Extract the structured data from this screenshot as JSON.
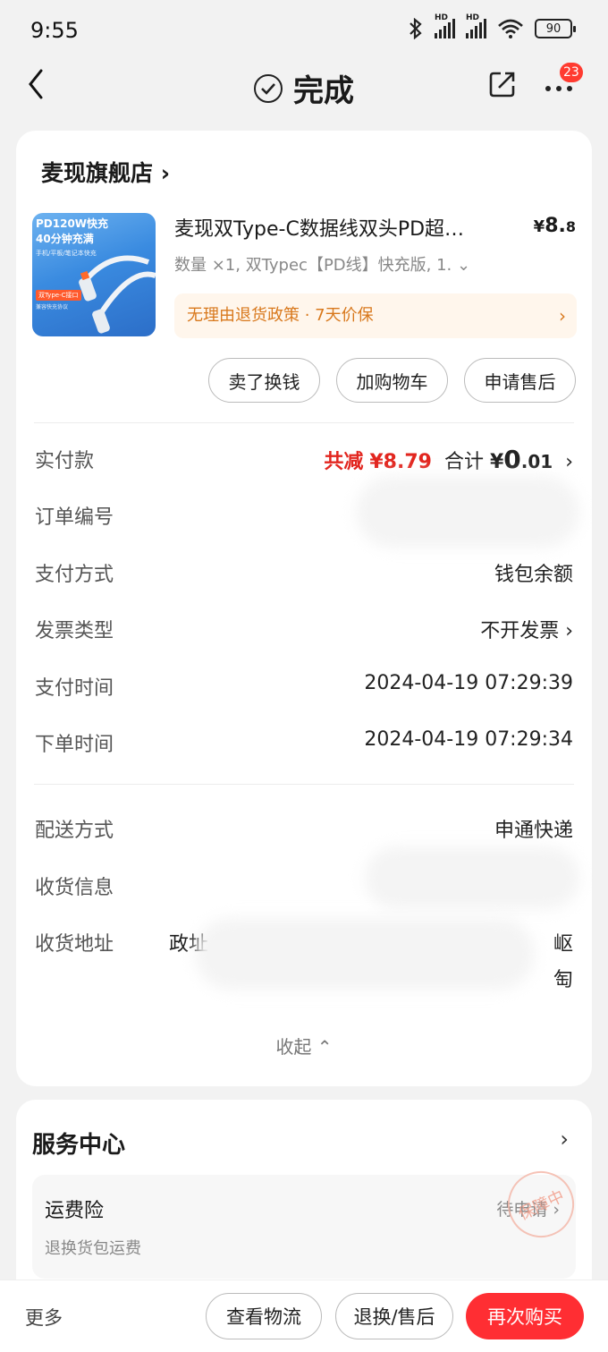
{
  "status_bar": {
    "time": "9:55",
    "battery": "90",
    "hd": "HD"
  },
  "header": {
    "title": "完成",
    "badge": "23"
  },
  "shop": {
    "name": "麦现旗舰店",
    "arrow": "›"
  },
  "product": {
    "name": "麦现双Type-C数据线双头PD超…",
    "price_currency": "¥",
    "price_int": "8.",
    "price_dec": "8",
    "spec": "数量 ×1, 双Typec【PD线】快充版, 1. ⌄",
    "thumb_line1": "PD120W快充",
    "thumb_line2": "40分钟充满",
    "thumb_line3": "手机/平板/笔记本快充",
    "thumb_tag": "双Type-C接口",
    "thumb_tag2": "兼容快充协议"
  },
  "policy": {
    "text": "无理由退货政策 · 7天价保",
    "arrow": "›"
  },
  "actions": {
    "sell": "卖了换钱",
    "cart": "加购物车",
    "after_sale": "申请售后"
  },
  "details": {
    "paid_label": "实付款",
    "discount_prefix": "共减",
    "discount": "¥8.79",
    "total_prefix": "合计",
    "total_currency": "¥",
    "total_int": "0",
    "total_dec": ".01",
    "order_no_label": "订单编号",
    "pay_method_label": "支付方式",
    "pay_method": "钱包余额",
    "invoice_label": "发票类型",
    "invoice": "不开发票",
    "pay_time_label": "支付时间",
    "pay_time": "2024-04-19 07:29:39",
    "order_time_label": "下单时间",
    "order_time": "2024-04-19 07:29:34",
    "delivery_label": "配送方式",
    "delivery": "申通快递",
    "receiver_label": "收货信息",
    "address_label": "收货地址",
    "address_frag1": "政址",
    "address_frag2": "岖",
    "address_frag3": "匋",
    "collapse": "收起 ⌃"
  },
  "service": {
    "title": "服务中心",
    "arrow": "›",
    "item_name": "运费险",
    "item_desc": "退换货包运费",
    "item_status": "待申请 ›",
    "stamp": "保障中"
  },
  "bottom": {
    "more": "更多",
    "logistics": "查看物流",
    "return": "退换/售后",
    "rebuy": "再次购买"
  }
}
